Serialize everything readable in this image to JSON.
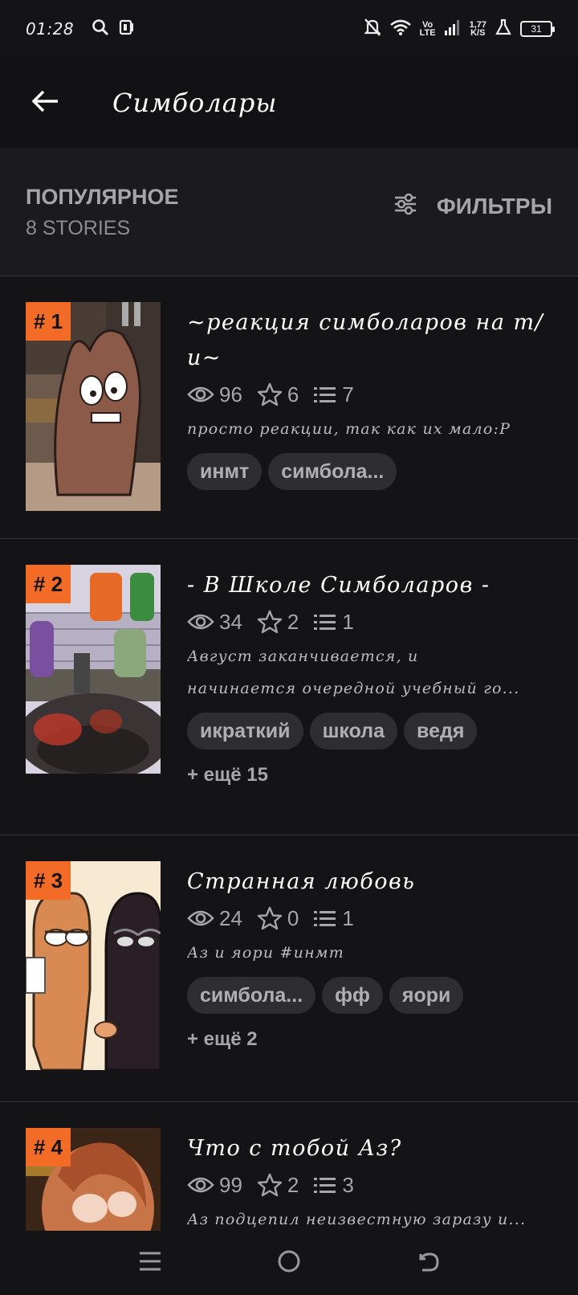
{
  "status": {
    "time": "01:28",
    "network_top": "Vo",
    "network_bottom": "LTE",
    "speed_top": "1,77",
    "speed_bottom": "K/S",
    "battery": "31"
  },
  "header": {
    "title": "Симболары"
  },
  "sort": {
    "title": "ПОПУЛЯРНОЕ",
    "count": "8 STORIES",
    "filters_label": "ФИЛЬТРЫ"
  },
  "stories": [
    {
      "rank": "# 1",
      "title": "~реакция симболаров на т/и~",
      "views": "96",
      "votes": "6",
      "parts": "7",
      "description": "просто реакции, так как их мало:Р",
      "tags": [
        "инмт",
        "симбола..."
      ],
      "more": ""
    },
    {
      "rank": "# 2",
      "title": "- В Школе Симболаров -",
      "views": "34",
      "votes": "2",
      "parts": "1",
      "description_line1": "Август заканчивается, и",
      "description_line2": "начинается очередной учебный го...",
      "tags": [
        "икраткий",
        "школа",
        "ведя"
      ],
      "more": "+ ещё 15"
    },
    {
      "rank": "# 3",
      "title": "Странная любовь",
      "views": "24",
      "votes": "0",
      "parts": "1",
      "description": "Аз и яори #инмт",
      "tags": [
        "симбола...",
        "фф",
        "яори"
      ],
      "more": "+ ещё 2"
    },
    {
      "rank": "# 4",
      "title": "Что с тобой Аз?",
      "views": "99",
      "votes": "2",
      "parts": "3",
      "description": "Аз подцепил неизвестную заразу и..."
    }
  ],
  "colors": {
    "background": "#141316",
    "rank_badge": "#f26b27",
    "tag_bg": "#2e2d31",
    "muted_text": "#a6a5a8"
  },
  "icons": [
    "back-arrow-icon",
    "filter-sliders-icon",
    "eye-icon",
    "star-icon",
    "list-icon",
    "menu-icon",
    "home-circle-icon",
    "return-icon"
  ]
}
